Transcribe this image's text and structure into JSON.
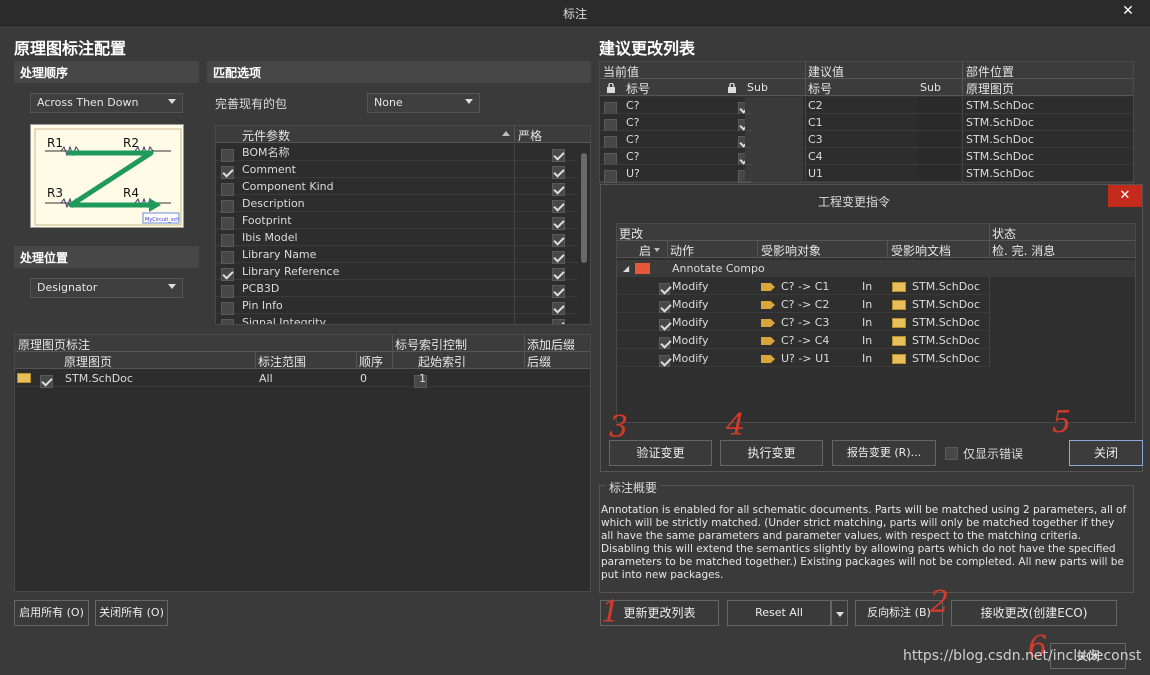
{
  "window": {
    "title": "标注"
  },
  "left": {
    "heading": "原理图标注配置",
    "order_section": "处理顺序",
    "order_value": "Across Then Down",
    "diagram_labels": [
      "R1",
      "R2",
      "R3",
      "R4"
    ],
    "diagram_caption": "MyCircuit_sch",
    "location_section": "处理位置",
    "location_value": "Designator",
    "match_section": "匹配选项",
    "complete_label": "完善现有的包",
    "complete_value": "None",
    "param_col": "元件参数",
    "strict_col": "严格",
    "params": [
      {
        "name": "BOM名称",
        "checked": false,
        "strict": true
      },
      {
        "name": "Comment",
        "checked": true,
        "strict": true
      },
      {
        "name": "Component Kind",
        "checked": false,
        "strict": true
      },
      {
        "name": "Description",
        "checked": false,
        "strict": true
      },
      {
        "name": "Footprint",
        "checked": false,
        "strict": true
      },
      {
        "name": "Ibis Model",
        "checked": false,
        "strict": true
      },
      {
        "name": "Library Name",
        "checked": false,
        "strict": true
      },
      {
        "name": "Library Reference",
        "checked": true,
        "strict": true
      },
      {
        "name": "PCB3D",
        "checked": false,
        "strict": true
      },
      {
        "name": "Pin Info",
        "checked": false,
        "strict": true
      },
      {
        "name": "Signal Integrity",
        "checked": false,
        "strict": true
      }
    ],
    "sheet_section": "原理图页标注",
    "index_section": "标号索引控制",
    "suffix_section": "添加后缀",
    "sheet_cols": [
      "原理图页",
      "标注范围",
      "顺序",
      "起始索引",
      "后缀"
    ],
    "sheets": [
      {
        "name": "STM.SchDoc",
        "scope": "All",
        "order": "0",
        "start": "1",
        "suffix": ""
      }
    ],
    "enable_all": "启用所有 (O)",
    "disable_all": "关闭所有 (O)"
  },
  "right": {
    "heading": "建议更改列表",
    "group_current": "当前值",
    "group_proposed": "建议值",
    "group_location": "部件位置",
    "col_designator": "标号",
    "col_sub": "Sub",
    "col_sheet": "原理图页",
    "rows": [
      {
        "current": "C?",
        "proposed": "C2",
        "sheet": "STM.SchDoc",
        "locked": true
      },
      {
        "current": "C?",
        "proposed": "C1",
        "sheet": "STM.SchDoc",
        "locked": true
      },
      {
        "current": "C?",
        "proposed": "C3",
        "sheet": "STM.SchDoc",
        "locked": true
      },
      {
        "current": "C?",
        "proposed": "C4",
        "sheet": "STM.SchDoc",
        "locked": true
      },
      {
        "current": "U?",
        "proposed": "U1",
        "sheet": "STM.SchDoc",
        "locked": false
      }
    ],
    "summary_section": "标注概要",
    "summary_text": "Annotation is enabled for all schematic documents. Parts will be matched using 2 parameters, all of which will be strictly matched. (Under strict matching, parts will only be matched together if they all have the same parameters and parameter values, with respect to the matching criteria. Disabling this will extend the semantics slightly by allowing parts which do not have the specified parameters to be matched together.) Existing packages will not be completed. All new parts will be put into new packages.",
    "btn_update": "更新更改列表",
    "btn_reset": "Reset All",
    "btn_back": "反向标注 (B)",
    "btn_accept": "接收更改(创建ECO)",
    "btn_close": "关闭"
  },
  "eco": {
    "title": "工程变更指令",
    "col_change": "更改",
    "col_status": "状态",
    "col_enable": "启",
    "col_action": "动作",
    "col_affected": "受影响对象",
    "col_doc": "受影响文档",
    "col_check": "检. 完. 消息",
    "group_label": "Annotate Compo",
    "rows": [
      {
        "action": "Modify",
        "object": "C? -> C1",
        "in": "In",
        "doc": "STM.SchDoc"
      },
      {
        "action": "Modify",
        "object": "C? -> C2",
        "in": "In",
        "doc": "STM.SchDoc"
      },
      {
        "action": "Modify",
        "object": "C? -> C3",
        "in": "In",
        "doc": "STM.SchDoc"
      },
      {
        "action": "Modify",
        "object": "C? -> C4",
        "in": "In",
        "doc": "STM.SchDoc"
      },
      {
        "action": "Modify",
        "object": "U? -> U1",
        "in": "In",
        "doc": "STM.SchDoc"
      }
    ],
    "btn_validate": "验证变更",
    "btn_execute": "执行变更",
    "btn_report": "报告变更 (R)...",
    "only_errors": "仅显示错误",
    "btn_close": "关闭"
  },
  "annotations": [
    "3",
    "4",
    "5",
    "1",
    "2",
    "6"
  ],
  "watermark": "https://blog.csdn.net/includeconst"
}
